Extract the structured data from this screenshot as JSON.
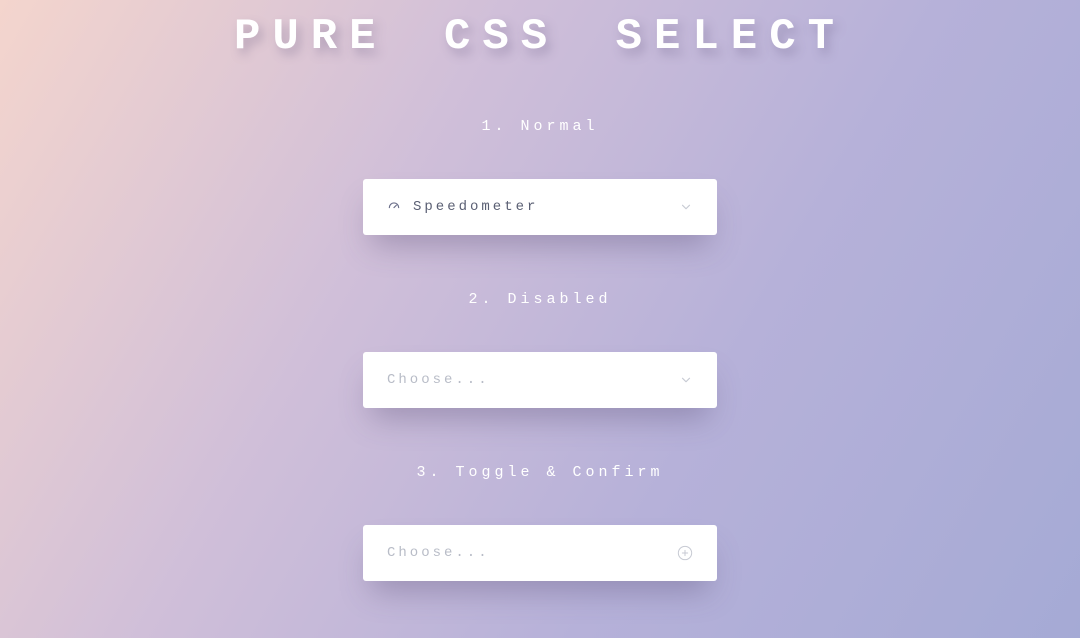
{
  "title": "PURE CSS SELECT",
  "sections": {
    "normal": {
      "label": "1. Normal",
      "selected": "Speedometer"
    },
    "disabled": {
      "label": "2. Disabled",
      "placeholder": "Choose..."
    },
    "toggle": {
      "label": "3. Toggle & Confirm",
      "placeholder": "Choose..."
    }
  }
}
